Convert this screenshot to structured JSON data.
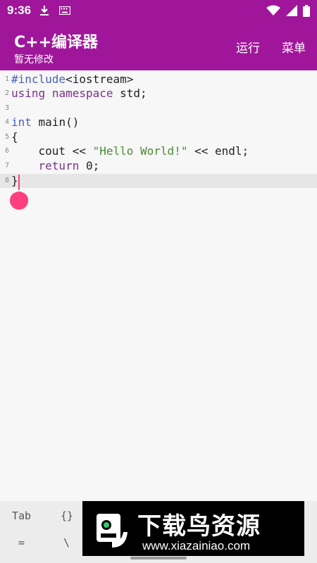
{
  "statusbar": {
    "time": "9:36",
    "left_icons": [
      "download-icon",
      "keyboard-icon"
    ],
    "right_icons": [
      "wifi-icon",
      "signal-icon",
      "battery-icon"
    ]
  },
  "appbar": {
    "title": "C++编译器",
    "subtitle": "暂无修改",
    "actions": {
      "run": "运行",
      "menu": "菜单"
    },
    "color": "#a0169a"
  },
  "editor": {
    "lines": [
      {
        "number": "1",
        "tokens": [
          {
            "text": "#include",
            "kind": "kw-blue"
          },
          {
            "text": "<iostream>",
            "kind": "plain"
          }
        ]
      },
      {
        "number": "2",
        "tokens": [
          {
            "text": "using",
            "kind": "kw"
          },
          {
            "text": " ",
            "kind": "plain"
          },
          {
            "text": "namespace",
            "kind": "kw"
          },
          {
            "text": " std;",
            "kind": "plain"
          }
        ]
      },
      {
        "number": "3",
        "tokens": []
      },
      {
        "number": "4",
        "tokens": [
          {
            "text": "int",
            "kind": "kw-blue"
          },
          {
            "text": " main()",
            "kind": "plain"
          }
        ]
      },
      {
        "number": "5",
        "tokens": [
          {
            "text": "{",
            "kind": "plain"
          }
        ]
      },
      {
        "number": "6",
        "tokens": [
          {
            "text": "    cout << ",
            "kind": "plain"
          },
          {
            "text": "\"Hello World!\"",
            "kind": "str"
          },
          {
            "text": " << endl;",
            "kind": "plain"
          }
        ]
      },
      {
        "number": "7",
        "tokens": [
          {
            "text": "    ",
            "kind": "plain"
          },
          {
            "text": "return",
            "kind": "kw"
          },
          {
            "text": " 0;",
            "kind": "plain"
          }
        ]
      },
      {
        "number": "8",
        "tokens": [
          {
            "text": "}",
            "kind": "plain"
          }
        ]
      }
    ],
    "current_line": 8,
    "cursor_color": "#ff3f7f"
  },
  "keyboard": {
    "keys": {
      "tab": "Tab",
      "braces": "{}",
      "equals": "=",
      "backslash": "\\"
    }
  },
  "watermark": {
    "title": "下载鸟资源",
    "url": "www.xiazainiao.com"
  }
}
